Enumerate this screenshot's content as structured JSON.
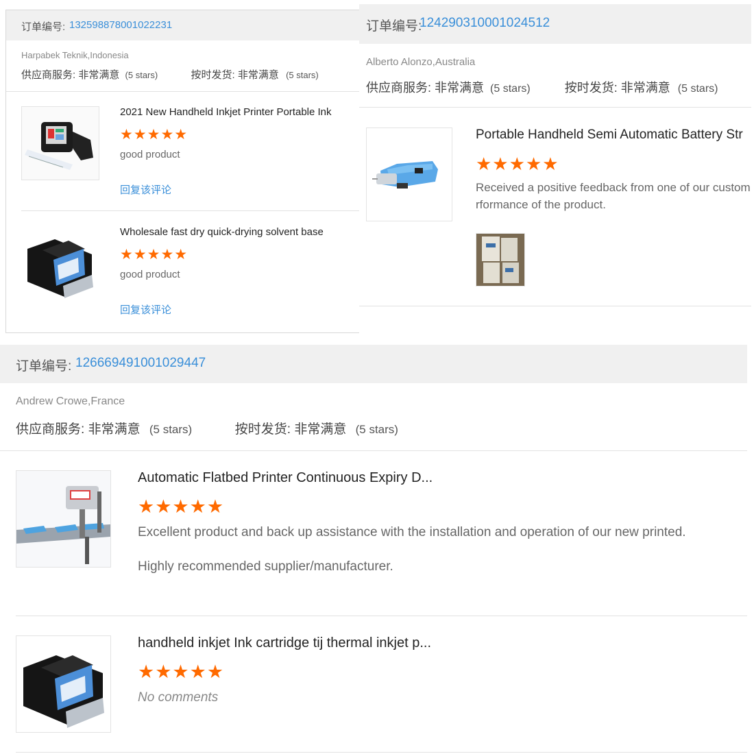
{
  "orders": [
    {
      "order_label": "订单编号:",
      "order_number": "132598878001022231",
      "buyer": "Harpabek Teknik,Indonesia",
      "supplier_service_label": "供应商服务:",
      "supplier_service_value": "非常满意",
      "supplier_service_stars": "(5 stars)",
      "on_time_label": "按时发货:",
      "on_time_value": "非常满意",
      "on_time_stars": "(5 stars)",
      "items": [
        {
          "title": "2021 New Handheld Inkjet Printer Portable Ink",
          "stars": "★★★★★",
          "comment": "good product",
          "reply": "回复该评论",
          "image_icon": "handheld-inkjet-printer-icon"
        },
        {
          "title": "Wholesale fast dry quick-drying solvent base",
          "stars": "★★★★★",
          "comment": "good product",
          "reply": "回复该评论",
          "image_icon": "ink-cartridge-icon"
        }
      ]
    },
    {
      "order_label": "订单编号:",
      "order_number": "124290310001024512",
      "buyer": "Alberto Alonzo,Australia",
      "supplier_service_label": "供应商服务:",
      "supplier_service_value": "非常满意",
      "supplier_service_stars": "(5 stars)",
      "on_time_label": "按时发货:",
      "on_time_value": "非常满意",
      "on_time_stars": "(5 stars)",
      "items": [
        {
          "title": "Portable Handheld Semi Automatic Battery Str",
          "stars": "★★★★★",
          "comment_line1": "Received a positive feedback from one of our custom",
          "comment_line2": "rformance of the product.",
          "image_icon": "strapping-tool-icon",
          "photo_icon": "boxes-photo-icon"
        }
      ]
    },
    {
      "order_label": "订单编号:",
      "order_number": "126669491001029447",
      "buyer": "Andrew Crowe,France",
      "supplier_service_label": "供应商服务:",
      "supplier_service_value": "非常满意",
      "supplier_service_stars": "(5 stars)",
      "on_time_label": "按时发货:",
      "on_time_value": "非常满意",
      "on_time_stars": "(5 stars)",
      "items": [
        {
          "title": "Automatic Flatbed Printer Continuous Expiry D...",
          "stars": "★★★★★",
          "comment_line1": "Excellent product and back up assistance with the installation and operation of our new printed.",
          "comment_line2": "Highly recommended supplier/manufacturer.",
          "image_icon": "flatbed-printer-icon"
        },
        {
          "title": "handheld inkjet Ink cartridge tij thermal inkjet p...",
          "stars": "★★★★★",
          "comment": "No comments",
          "image_icon": "ink-cartridge-icon"
        }
      ]
    }
  ],
  "colors": {
    "link_blue": "#3a8fd9",
    "star_orange": "#ff6a00",
    "header_bg": "#f0f0f0"
  }
}
